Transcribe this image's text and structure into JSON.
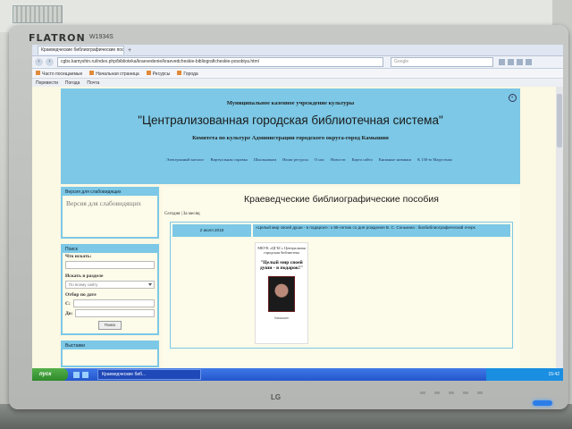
{
  "monitor": {
    "brand": "FLATRON",
    "model": "W1934S",
    "maker": "LG"
  },
  "browser": {
    "tab_title": "Краеведческие библиографические пособия",
    "new_tab": "+",
    "url": "cgbs.kamyshin.ru/index.php/biblioteka/kraevedenie/kraevedcheskie-bibliograficheskie-posobiya.html",
    "search_placeholder": "Google",
    "bookmarks": [
      "Часто посещаемые",
      "Начальная страница",
      "Ресурсы",
      "Города"
    ],
    "addons": [
      "Перевести",
      "Погода",
      "Почта"
    ]
  },
  "site": {
    "org": "Муниципальное казенное учреждение культуры",
    "name": "\"Централизованная городская библиотечная система\"",
    "committee": "Комитета по культуре Администрации городского округа-город Камышин",
    "nav": [
      "Электронный каталог",
      "Виртуальная справка",
      "Школьникам",
      "Наши ресурсы",
      "О нас",
      "Новости",
      "Карта сайта",
      "Книжные новинки",
      "К 150-ю Марусенко"
    ],
    "page_title": "Краеведческие библиографические пособия",
    "breadcrumb": "Сегодня | За месяц",
    "sidebar": {
      "accessibility_header": "Версия для слабовидящих",
      "accessibility_link": "Версия для слабовидящих",
      "search_header": "Поиск",
      "search_label": "Что искать:",
      "section_label": "Искать в разделе",
      "section_value": "По всему сайту",
      "date_label": "Отбор по дате",
      "from_label": "С:",
      "to_label": "До:",
      "search_button": "Поиск",
      "exhibits_header": "Выставки"
    },
    "item": {
      "date": "2 июля 2018",
      "title": "«Целый мир своей души - в подарок!»: к 85-летию со дня рождения В. С. Сонькина : биобиблиографический очерк",
      "cover_header": "МКУК «ЦГБС» Центральная городская библиотека",
      "cover_title": "\"Целый мир своей души - в подарок!\"",
      "cover_footer": "Камышин"
    }
  },
  "taskbar": {
    "start": "пуск",
    "window": "Краеведческие биб...",
    "clock": "15:42"
  }
}
